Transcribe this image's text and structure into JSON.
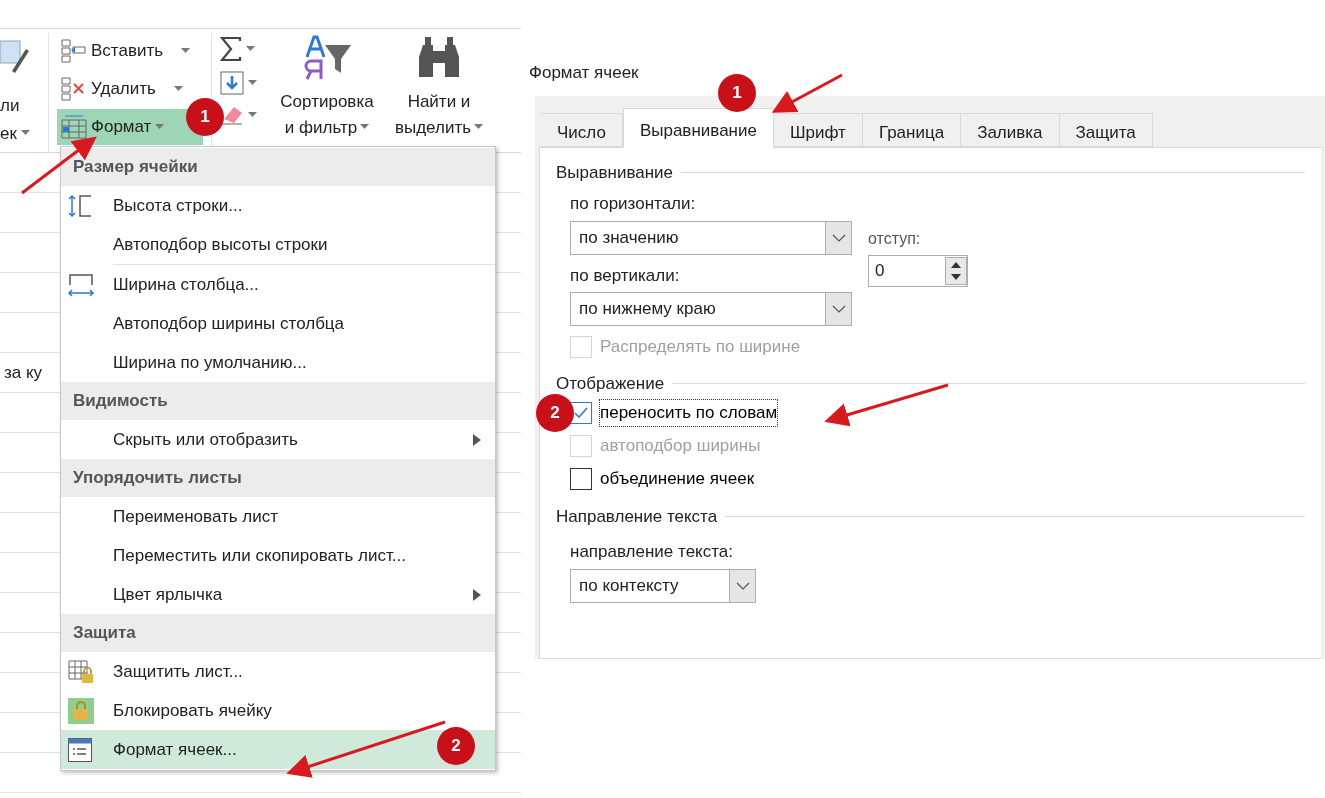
{
  "ribbon": {
    "cut_labels": [
      "ли",
      "ек"
    ],
    "cells_group": [
      {
        "label": "Вставить",
        "selected": false
      },
      {
        "label": "Удалить",
        "selected": false
      },
      {
        "label": "Формат",
        "selected": true
      }
    ],
    "sort_button": {
      "line_1": "Сортировка",
      "line_2": "и фильтр"
    },
    "find_button": {
      "line_1": "Найти и",
      "line_2": "выделить"
    }
  },
  "sheet": {
    "cell_text": "за ку"
  },
  "format_menu": {
    "items": [
      {
        "kind": "header",
        "label": "Размер ячейки"
      },
      {
        "kind": "item",
        "label": "Высота строки...",
        "submenu": false,
        "selected": false
      },
      {
        "kind": "item",
        "label": "Автоподбор высоты строки",
        "submenu": false,
        "selected": false
      },
      {
        "kind": "item",
        "label": "Ширина столбца...",
        "submenu": false,
        "selected": false
      },
      {
        "kind": "item",
        "label": "Автоподбор ширины столбца",
        "submenu": false,
        "selected": false
      },
      {
        "kind": "item",
        "label": "Ширина по умолчанию...",
        "submenu": false,
        "selected": false
      },
      {
        "kind": "header",
        "label": "Видимость"
      },
      {
        "kind": "item",
        "label": "Скрыть или отобразить",
        "submenu": true,
        "selected": false
      },
      {
        "kind": "header",
        "label": "Упорядочить листы"
      },
      {
        "kind": "item",
        "label": "Переименовать лист",
        "submenu": false,
        "selected": false
      },
      {
        "kind": "item",
        "label": "Переместить или скопировать лист...",
        "submenu": false,
        "selected": false
      },
      {
        "kind": "item",
        "label": "Цвет ярлычка",
        "submenu": true,
        "selected": false
      },
      {
        "kind": "header",
        "label": "Защита"
      },
      {
        "kind": "item",
        "label": "Защитить лист...",
        "submenu": false,
        "selected": false
      },
      {
        "kind": "item",
        "label": "Блокировать ячейку",
        "submenu": false,
        "selected": false
      },
      {
        "kind": "item",
        "label": "Формат ячеек...",
        "submenu": false,
        "selected": true
      }
    ]
  },
  "dialog": {
    "title": "Формат ячеек",
    "tabs": [
      {
        "label": "Число",
        "selected": false
      },
      {
        "label": "Выравнивание",
        "selected": true
      },
      {
        "label": "Шрифт",
        "selected": false
      },
      {
        "label": "Граница",
        "selected": false
      },
      {
        "label": "Заливка",
        "selected": false
      },
      {
        "label": "Защита",
        "selected": false
      }
    ],
    "alignment": {
      "title": "Выравнивание",
      "horizontal_label": "по горизонтали:",
      "horizontal_value": "по значению",
      "vertical_label": "по вертикали:",
      "vertical_value": "по нижнему краю",
      "indent_label": "отступ:",
      "indent_value": "0",
      "distribute": {
        "label": "Распределять по ширине",
        "checked": false,
        "disabled": true
      }
    },
    "display": {
      "title": "Отображение",
      "options": [
        {
          "label": "переносить по словам",
          "checked": true,
          "disabled": false
        },
        {
          "label": "автоподбор ширины",
          "checked": false,
          "disabled": true
        },
        {
          "label": "объединение ячеек",
          "checked": false,
          "disabled": false
        }
      ]
    },
    "direction": {
      "title": "Направление текста",
      "label": "направление текста:",
      "value": "по контексту"
    }
  },
  "annotations": {
    "badges": [
      "1",
      "2",
      "1",
      "2"
    ]
  }
}
